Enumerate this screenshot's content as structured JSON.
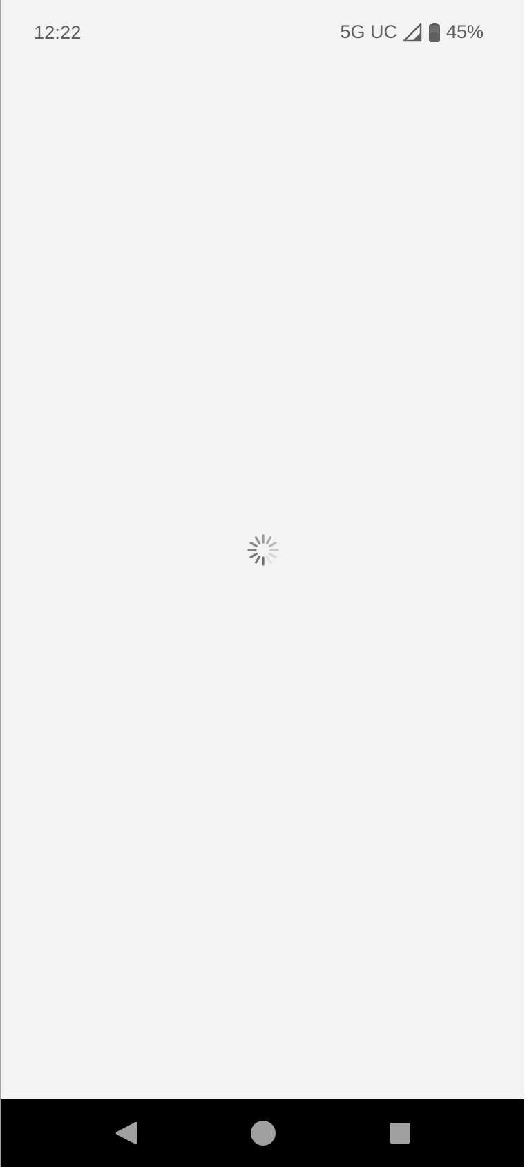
{
  "status_bar": {
    "time": "12:22",
    "network": "5G UC",
    "battery_percent": "45%",
    "battery_level": 0.45,
    "icons": [
      "signal-icon",
      "battery-icon"
    ]
  },
  "content": {
    "state": "loading",
    "icon": "loading-spinner-icon"
  },
  "navigation_bar": {
    "buttons": [
      "back-icon",
      "home-icon",
      "recents-icon"
    ]
  },
  "colors": {
    "background": "#f3f3f3",
    "status_text": "#5f5f5f",
    "nav_bar": "#000000",
    "nav_icons": "#a0a0a0"
  }
}
